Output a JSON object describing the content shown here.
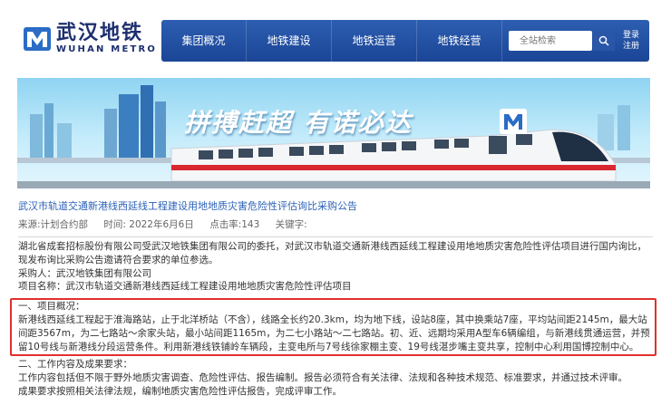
{
  "header": {
    "logo_cn": "武汉地铁",
    "logo_en": "WUHAN METRO",
    "nav": [
      "集团概况",
      "地铁建设",
      "地铁运营",
      "地铁经营"
    ],
    "search_placeholder": "全站检索",
    "login": "登录",
    "register": "注册"
  },
  "banner": {
    "slogan": "拼搏赶超  有诺必达"
  },
  "article": {
    "title": "武汉市轨道交通新港线西延线工程建设用地地质灾害危险性评估询比采购公告",
    "meta": {
      "source": "来源:计划合约部",
      "time": "时间: 2022年6月6日",
      "clicks": "点击率:143",
      "keywords": "关键字:"
    },
    "intro": "湖北省成套招标股份有限公司受武汉地铁集团有限公司的委托，对武汉市轨道交通新港线西延线工程建设用地地质灾害危险性评估项目进行国内询比，现发布询比采购公告邀请符合要求的单位参选。",
    "purchaser": "采购人：武汉地铁集团有限公司",
    "project_name": "项目名称：武汉市轨道交通新港线西延线工程建设用地地质灾害危险性评估项目",
    "section1_heading": "一、项目概况：",
    "section1_text": "新港线西延线工程起于淮海路站，止于北洋桥站（不含），线路全长约20.3km，均为地下线，设站8座，其中换乘站7座，平均站间距2145m，最大站间距3567m，为二七路站～余家头站，最小站间距1165m，为二七小路站～二七路站。初、近、远期均采用A型车6辆编组，与新港线贯通运营，并预留10号线与新港线分段运营条件。利用新港线铁铺岭车辆段，主变电所与7号线徐家棚主变、19号线湛步嘴主变共享，控制中心利用国博控制中心。",
    "section2_heading": "二、工作内容及成果要求：",
    "section2_text1": "工作内容包括但不限于野外地质灾害调查、危险性评估、报告编制。报告必须符合有关法律、法规和各种技术规范、标准要求，并通过技术评审。",
    "section2_text2": "成果要求按照相关法律法规，编制地质灾害危险性评估报告，完成评审工作。"
  },
  "colors": {
    "nav_bg": "#1b4596",
    "link": "#2d62b7",
    "highlight_border": "#e0302f",
    "logo": "#1d2f6f"
  },
  "icons": [
    "metro-logo-icon",
    "search-icon",
    "metro-badge-icon"
  ]
}
